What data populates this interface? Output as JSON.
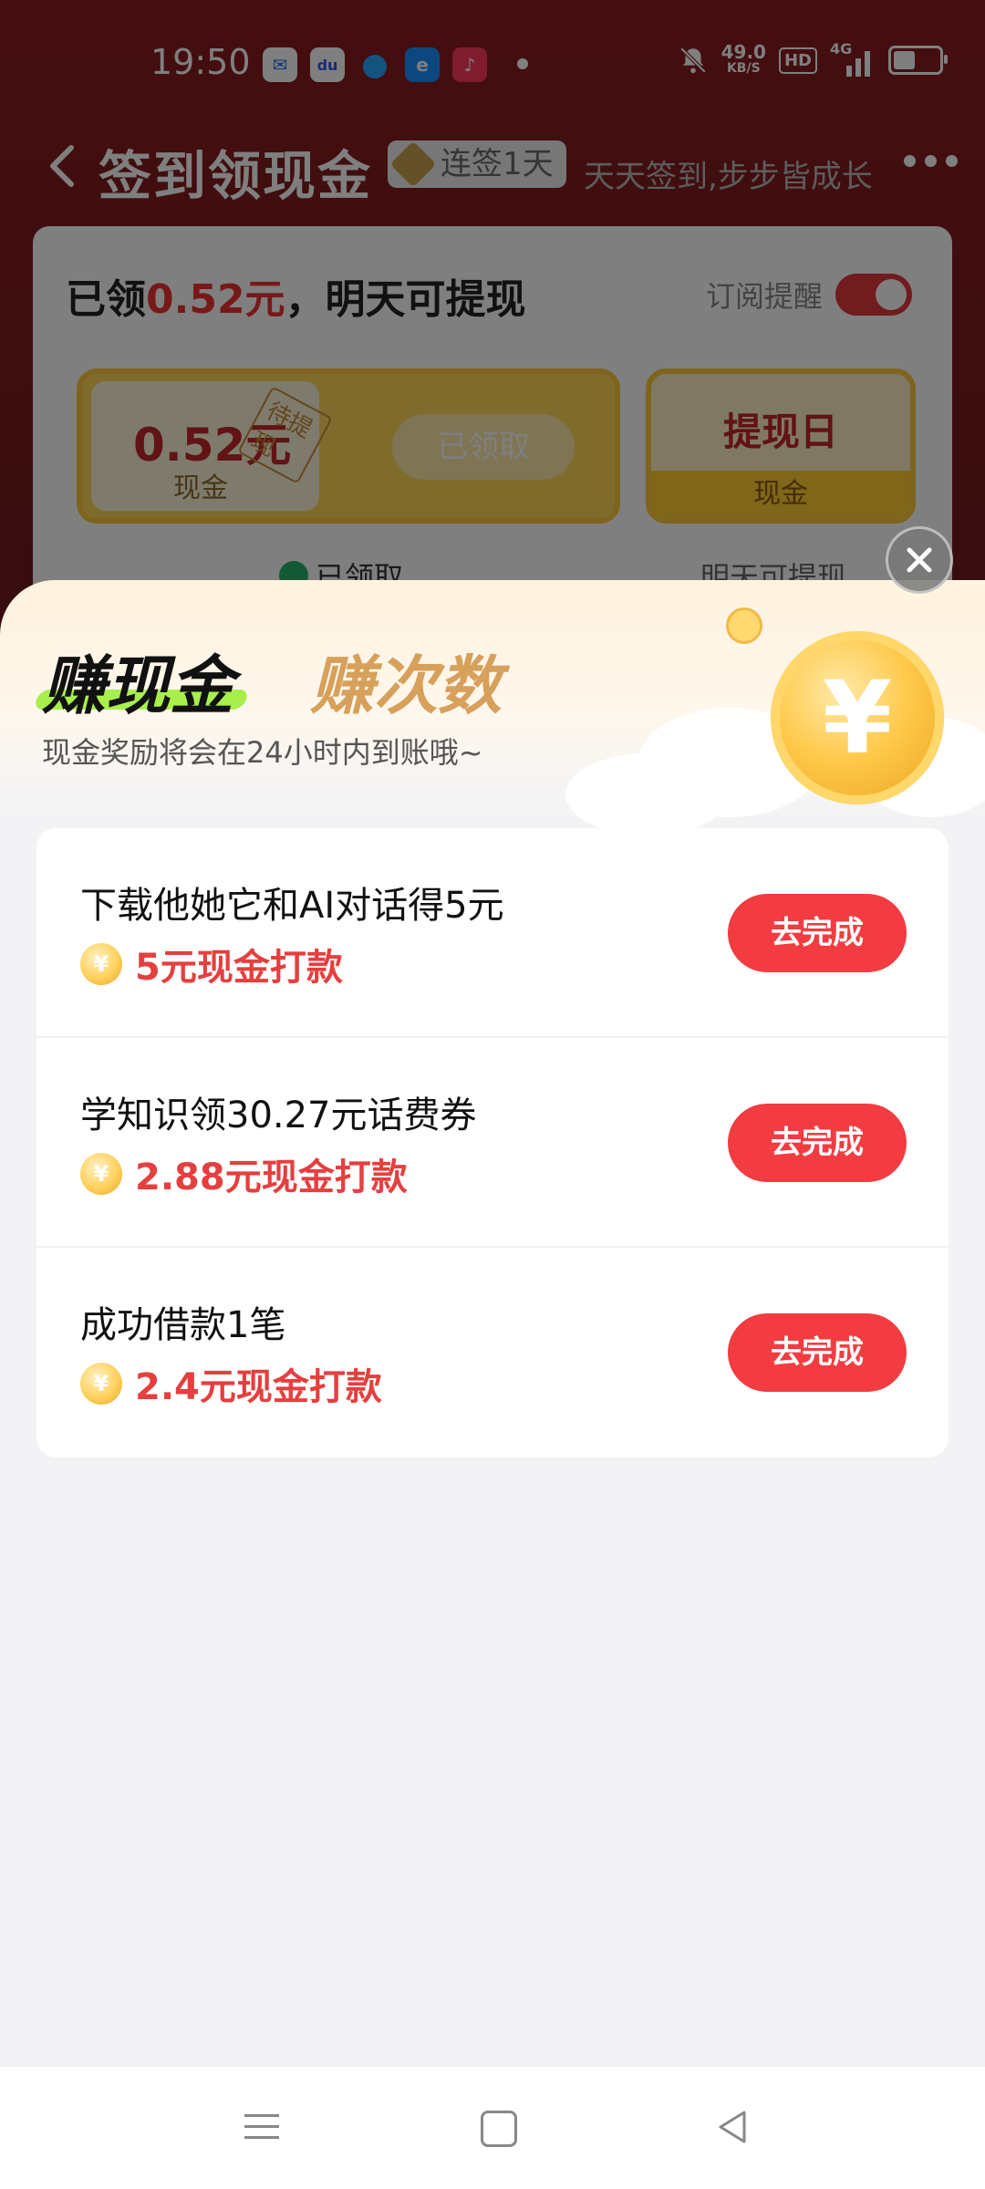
{
  "status_bar": {
    "time": "19:50",
    "apps": [
      {
        "name": "mail-app-icon",
        "bg": "#ffffff",
        "fg": "#1a73e8",
        "glyph": "✉"
      },
      {
        "name": "baidu-app-icon",
        "bg": "#ffffff",
        "fg": "#2d5be3",
        "glyph": "du"
      },
      {
        "name": "qq-app-icon",
        "bg": "#7a1a1f",
        "fg": "#2aa6ff",
        "glyph": "●"
      },
      {
        "name": "eleme-app-icon",
        "bg": "#1890ff",
        "fg": "#ffffff",
        "glyph": "e"
      },
      {
        "name": "music-app-icon",
        "bg": "#ff3b5c",
        "fg": "#ffffff",
        "glyph": "♪"
      }
    ],
    "net_speed_value": "49.0",
    "net_speed_unit": "KB/S",
    "hd": "HD",
    "network": "4G",
    "battery_level": 0.5
  },
  "navbar": {
    "title": "签到领现金",
    "streak": "连签1天",
    "slogan": "天天签到,步步皆成长"
  },
  "sign_card": {
    "headline_prefix": "已领",
    "headline_amount": "0.52元",
    "headline_suffix": "，明天可提现",
    "reminder_label": "订阅提醒",
    "reminder_on": true,
    "reward_amount": "0.52元",
    "reward_unit": "现金",
    "pending_stamp": "待提现",
    "claimed_button": "已领取",
    "withdraw_title": "提现日",
    "withdraw_sub": "现金",
    "status_claimed": "已领取",
    "status_tomorrow": "明天可提现"
  },
  "sheet": {
    "tab_cash": "赚现金",
    "tab_count": "赚次数",
    "subtitle": "现金奖励将会在24小时内到账哦~",
    "coin_symbol": "¥",
    "tasks": [
      {
        "title": "下载他她它和AI对话得5元",
        "reward": "5元现金打款",
        "button": "去完成"
      },
      {
        "title": "学知识领30.27元话费券",
        "reward": "2.88元现金打款",
        "button": "去完成"
      },
      {
        "title": "成功借款1笔",
        "reward": "2.4元现金打款",
        "button": "去完成"
      }
    ]
  },
  "colors": {
    "accent_red": "#f23c41",
    "reward_red": "#e53f3f",
    "header_bg": "#7a1a1f",
    "tab_underline": "#a8ef4d"
  }
}
